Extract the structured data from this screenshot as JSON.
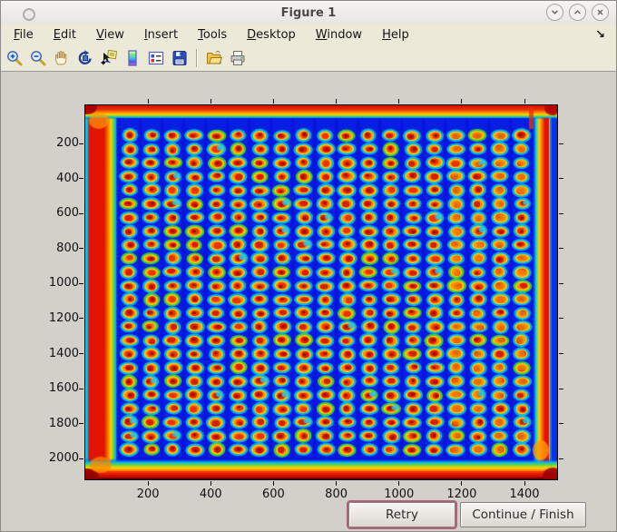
{
  "window": {
    "title": "Figure 1",
    "controls": [
      {
        "name": "minimize",
        "icon": "chevron-down"
      },
      {
        "name": "maximize",
        "icon": "chevron-up"
      },
      {
        "name": "close",
        "icon": "x"
      }
    ]
  },
  "menubar": {
    "items": [
      {
        "label": "File",
        "mnemonic": "F"
      },
      {
        "label": "Edit",
        "mnemonic": "E"
      },
      {
        "label": "View",
        "mnemonic": "V"
      },
      {
        "label": "Insert",
        "mnemonic": "I"
      },
      {
        "label": "Tools",
        "mnemonic": "T"
      },
      {
        "label": "Desktop",
        "mnemonic": "D"
      },
      {
        "label": "Window",
        "mnemonic": "W"
      },
      {
        "label": "Help",
        "mnemonic": "H"
      }
    ],
    "dock_arrow": "↘"
  },
  "toolbar": {
    "buttons": [
      {
        "name": "zoom-in"
      },
      {
        "name": "zoom-out"
      },
      {
        "name": "pan"
      },
      {
        "name": "rotate-3d"
      },
      {
        "name": "data-cursor"
      },
      {
        "name": "insert-colorbar"
      },
      {
        "name": "insert-legend"
      },
      {
        "name": "save-figure"
      },
      {
        "name": "separator"
      },
      {
        "name": "open-file"
      },
      {
        "name": "print-figure"
      }
    ]
  },
  "chart_data": {
    "type": "heatmap",
    "title": "",
    "xlabel": "",
    "ylabel": "",
    "x_ticks": [
      200,
      400,
      600,
      800,
      1000,
      1200,
      1400
    ],
    "y_ticks": [
      200,
      400,
      600,
      800,
      1000,
      1200,
      1400,
      1600,
      1800,
      2000
    ],
    "x_range": [
      0,
      1504
    ],
    "y_range": [
      -18,
      2118
    ],
    "colormap": "jet",
    "content": "microarray slide scan: deep blue field, hot red/orange glowing edges, regular grid of spots (cyan ring, yellow-orange halo, red core)",
    "spot_grid": {
      "rows": 24,
      "cols": 19,
      "first_center_x": 140,
      "first_center_y": 155,
      "dx": 69.5,
      "dy": 78,
      "spot_rx_units": 21,
      "spot_ry_units": 27
    },
    "colors": {
      "field": "#0714dd",
      "ring": "#00bce8",
      "ring_green": "#3ed43c",
      "mid_yellow": "#ffd800",
      "mid_orange": "#ff8a00",
      "core_reds": [
        "#e01800",
        "#d42000",
        "#f03000"
      ],
      "core_dark": "#a00a00",
      "edge_red": "#e01400",
      "edge_dark": "#8f0000"
    }
  },
  "buttons": {
    "retry": {
      "label": "Retry",
      "focused": true
    },
    "continue_finish": {
      "label": "Continue / Finish"
    }
  },
  "colors": {
    "titlebar": "#f0efec",
    "menubar": "#ece9d9",
    "figure_bg": "#d3d0ca",
    "focus_ring": "#b2617b"
  }
}
